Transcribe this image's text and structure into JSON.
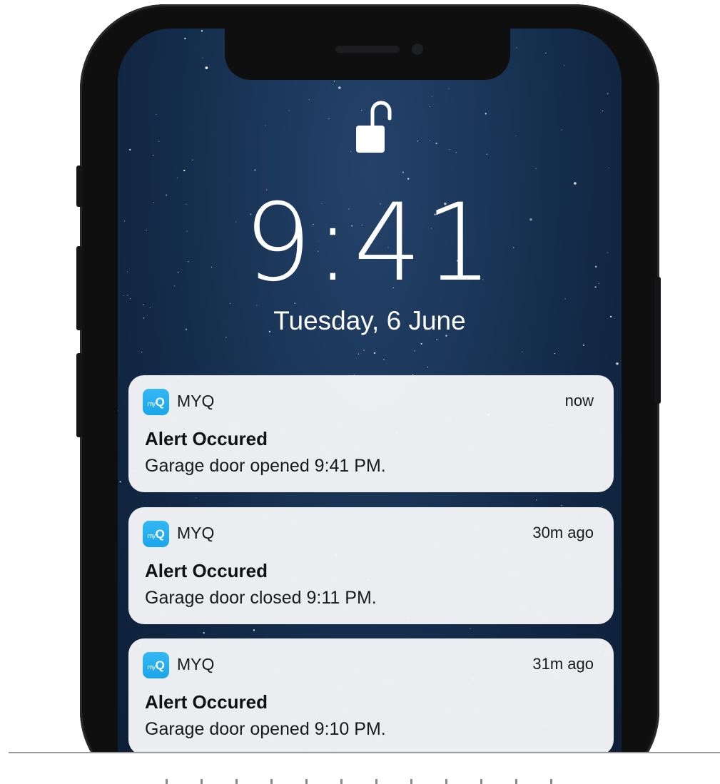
{
  "lock_screen": {
    "status_icon": "unlocked-padlock-icon",
    "time": "9:41",
    "date": "Tuesday, 6 June"
  },
  "notifications": [
    {
      "app_icon": "myq-app-icon",
      "app_name": "MYQ",
      "timestamp": "now",
      "title": "Alert Occured",
      "message": "Garage door opened 9:41 PM."
    },
    {
      "app_icon": "myq-app-icon",
      "app_name": "MYQ",
      "timestamp": "30m ago",
      "title": "Alert Occured",
      "message": "Garage door closed 9:11 PM."
    },
    {
      "app_icon": "myq-app-icon",
      "app_name": "MYQ",
      "timestamp": "31m ago",
      "title": "Alert Occured",
      "message": "Garage door opened 9:10 PM."
    }
  ],
  "colors": {
    "wallpaper": "#1a3557",
    "notification_bg": "#f3f4f6",
    "app_icon": "#1aa6ea",
    "phone_frame": "#0f0f10"
  }
}
